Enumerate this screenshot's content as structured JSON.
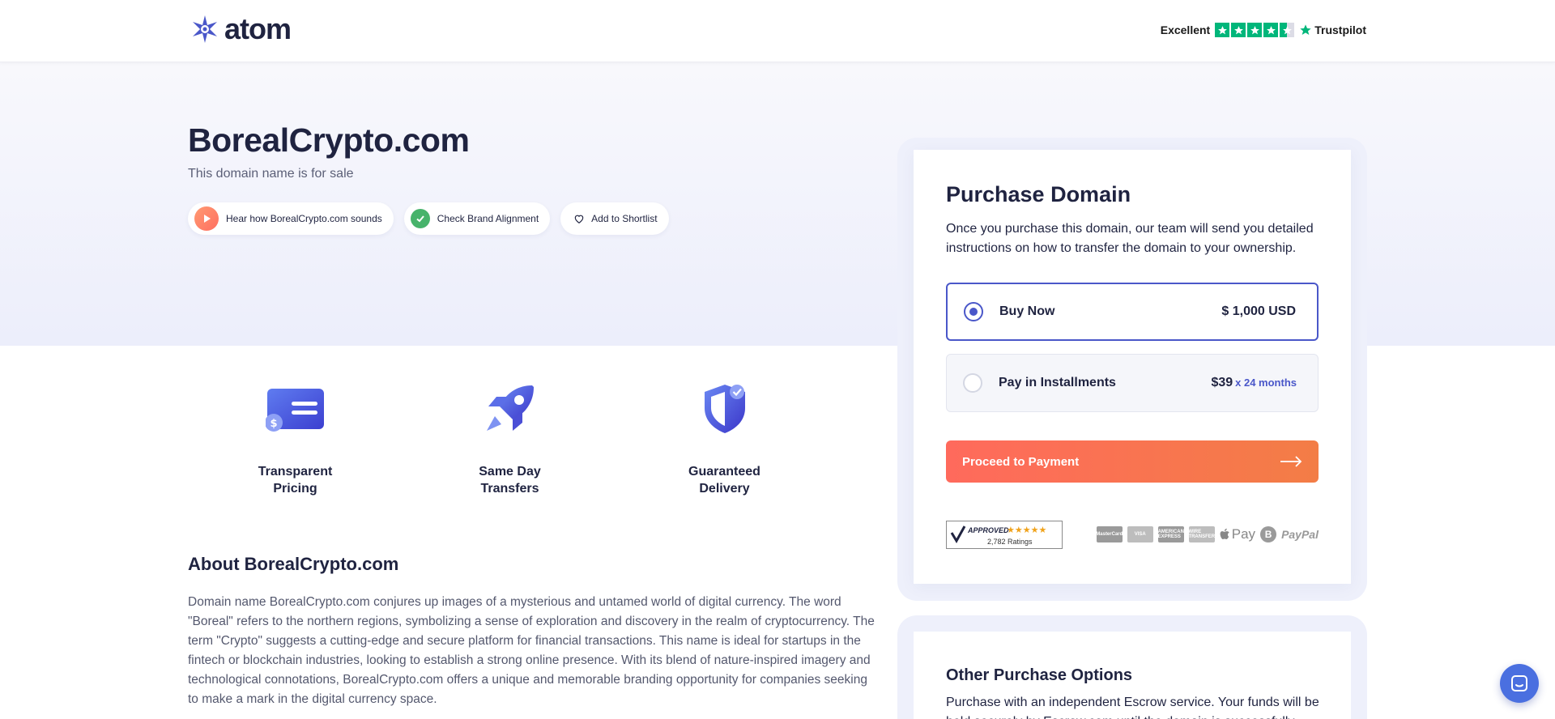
{
  "brand": {
    "name": "atom"
  },
  "trustpilot": {
    "rating_word": "Excellent",
    "brand": "Trustpilot",
    "stars": 4.5
  },
  "hero": {
    "domain": "BorealCrypto.com",
    "subtitle": "This domain name is for sale",
    "pills": {
      "sound": "Hear how BorealCrypto.com sounds",
      "alignment": "Check Brand Alignment",
      "shortlist": "Add to Shortlist"
    }
  },
  "features": [
    {
      "label": "Transparent Pricing",
      "icon": "pricing-card-icon"
    },
    {
      "label": "Same Day Transfers",
      "icon": "rocket-icon"
    },
    {
      "label": "Guaranteed Delivery",
      "icon": "shield-check-icon"
    }
  ],
  "about": {
    "title": "About BorealCrypto.com",
    "text": "Domain name BorealCrypto.com conjures up images of a mysterious and untamed world of digital currency. The word \"Boreal\" refers to the northern regions, symbolizing a sense of exploration and discovery in the realm of cryptocurrency. The term \"Crypto\" suggests a cutting-edge and secure platform for financial transactions. This name is ideal for startups in the fintech or blockchain industries, looking to establish a strong online presence. With its blend of nature-inspired imagery and technological connotations, BorealCrypto.com offers a unique and memorable branding opportunity for companies seeking to make a mark in the digital currency space."
  },
  "purchase": {
    "title": "Purchase Domain",
    "description": "Once you purchase this domain, our team will send you detailed instructions on how to transfer the domain to your ownership.",
    "buy_now": {
      "label": "Buy Now",
      "price": "$ 1,000 USD",
      "selected": true
    },
    "installments": {
      "label": "Pay in Installments",
      "price": "$39",
      "term": "x 24 months",
      "selected": false
    },
    "proceed": "Proceed to Payment",
    "approved": {
      "word": "APPROVED",
      "ratings": "2,782 Ratings"
    },
    "payments": {
      "mastercard": "MasterCard",
      "visa": "VISA",
      "amex": "AMERICAN EXPRESS",
      "wire": "WIRE TRANSFER",
      "apple_pay": "Pay",
      "bitcoin": "B",
      "paypal": "PayPal"
    }
  },
  "other": {
    "title": "Other Purchase Options",
    "text": "Purchase with an independent Escrow service. Your funds will be held securely by Escrow.com until the domain is successfully"
  },
  "colors": {
    "primary": "#4a57c9",
    "cta_start": "#ff6a5c",
    "cta_end": "#f37d46",
    "trustpilot_green": "#00b67a",
    "text": "#1f2340"
  }
}
